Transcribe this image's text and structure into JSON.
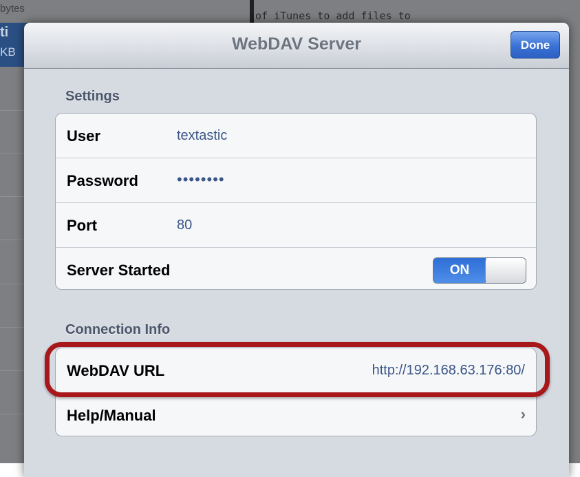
{
  "background": {
    "left_partial_text_top": "bytes",
    "left_partial_selected_1": "ti",
    "left_partial_selected_2": "KB",
    "code_text": "of iTunes to add files to"
  },
  "navbar": {
    "title": "WebDAV Server",
    "done_label": "Done"
  },
  "settings": {
    "header": "Settings",
    "user_label": "User",
    "user_value": "textastic",
    "password_label": "Password",
    "password_value": "••••••••",
    "port_label": "Port",
    "port_value": "80",
    "server_label": "Server Started",
    "server_toggle": "ON"
  },
  "connection": {
    "header": "Connection Info",
    "url_label": "WebDAV URL",
    "url_value": "http://192.168.63.176:80/",
    "help_label": "Help/Manual",
    "help_chevron": "›"
  },
  "colors": {
    "accent_blue": "#3a72d6",
    "highlight_red": "#a8181b",
    "value_text": "#3a5586"
  }
}
